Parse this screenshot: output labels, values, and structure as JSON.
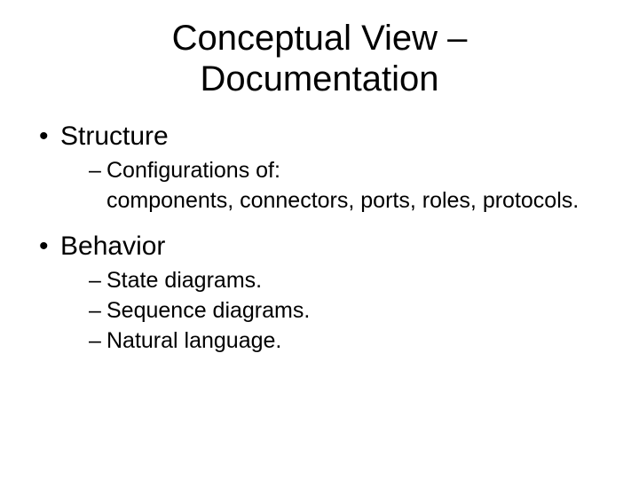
{
  "title": "Conceptual View – Documentation",
  "sections": [
    {
      "heading": "Structure",
      "items": [
        {
          "lead": "Configurations of:",
          "continuation": "components, connectors, ports, roles, protocols."
        }
      ]
    },
    {
      "heading": "Behavior",
      "items": [
        {
          "lead": "State diagrams."
        },
        {
          "lead": "Sequence diagrams."
        },
        {
          "lead": "Natural language."
        }
      ]
    }
  ]
}
